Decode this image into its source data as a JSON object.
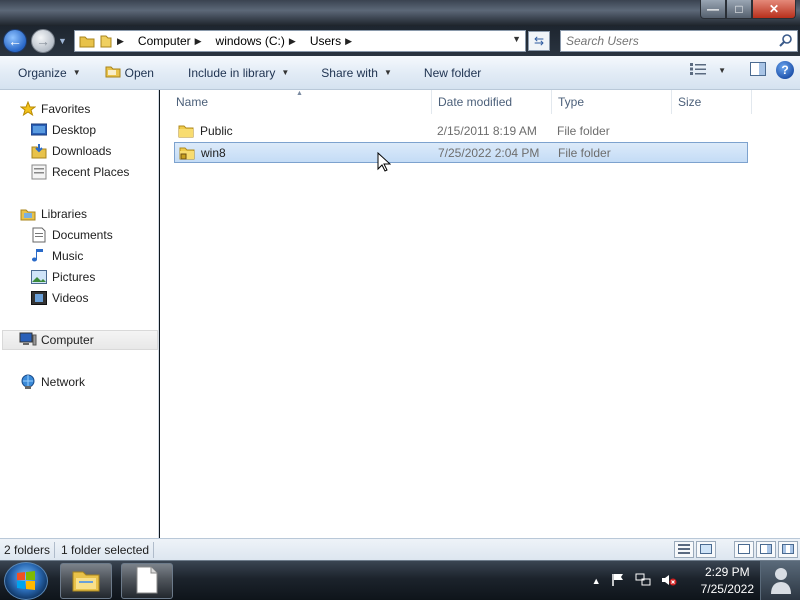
{
  "window": {
    "minimize_icon": "minimize-icon",
    "maximize_icon": "maximize-icon",
    "close_icon": "close-icon"
  },
  "address": {
    "crumbs": [
      "Computer",
      "windows (C:)",
      "Users"
    ],
    "search_placeholder": "Search Users"
  },
  "toolbar": {
    "organize": "Organize",
    "open": "Open",
    "include_in_library": "Include in library",
    "share_with": "Share with",
    "new_folder": "New folder"
  },
  "nav": {
    "favorites": "Favorites",
    "desktop": "Desktop",
    "downloads": "Downloads",
    "recent_places": "Recent Places",
    "libraries": "Libraries",
    "documents": "Documents",
    "music": "Music",
    "pictures": "Pictures",
    "videos": "Videos",
    "computer": "Computer",
    "network": "Network"
  },
  "columns": {
    "name": "Name",
    "date_modified": "Date modified",
    "type": "Type",
    "size": "Size"
  },
  "files": [
    {
      "name": "Public",
      "date": "2/15/2011 8:19 AM",
      "type": "File folder",
      "selected": false
    },
    {
      "name": "win8",
      "date": "7/25/2022 2:04 PM",
      "type": "File folder",
      "selected": true
    }
  ],
  "status": {
    "count": "2 folders",
    "selection": "1 folder selected"
  },
  "taskbar": {
    "time": "2:29 PM",
    "date": "7/25/2022"
  },
  "colors": {
    "selection_bg": "#c4dcf6",
    "selection_border": "#7da2ce",
    "toolbar_text": "#1e3250"
  }
}
